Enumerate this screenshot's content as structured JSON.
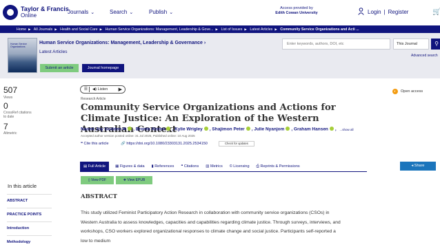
{
  "header": {
    "logo_line1": "Taylor & Francis",
    "logo_line2": "Online",
    "nav": [
      "Journals",
      "Search",
      "Publish"
    ],
    "access_label": "Access provided by",
    "access_org": "Edith Cowan University",
    "login": "Login",
    "register": "Register"
  },
  "breadcrumb": [
    "Home",
    "All Journals",
    "Health and Social Care",
    "Human Service Organizations: Management, Leadership & Gove...",
    "List of Issues",
    "Latest Articles",
    "Community Service Organizations and Acti ..."
  ],
  "journal": {
    "cover_title": "Human Service Organizations",
    "title": "Human Service Organizations: Management, Leadership & Governance",
    "issue": "Latest Articles",
    "submit": "Submit an article",
    "homepage": "Journal homepage"
  },
  "search": {
    "placeholder": "Enter keywords, authors, DOI, etc",
    "scope": "This Journal",
    "advanced": "Advanced search"
  },
  "metrics": [
    {
      "value": "507",
      "label": "Views"
    },
    {
      "value": "0",
      "label": "CrossRef citations to date"
    },
    {
      "value": "7",
      "label": "Altmetric"
    }
  ],
  "article": {
    "listen": "Listen",
    "type": "Research Article",
    "title": "Community Service Organizations and Actions for Climate Justice: An Exploration of the Western Australian Context",
    "authors": [
      "Naomi Joy Godden",
      "Bronte Alston",
      "Kylie Wrigley",
      "Shajimon Peter",
      "Julie Nyanjom",
      "Graham Hansen"
    ],
    "show_all": "...show all",
    "dates": "Accepted author version posted online: 31 Jul 2025, Published online: 10 Aug 2025",
    "cite": "Cite this article",
    "doi": "https://doi.org/10.1080/23303131.2025.2534150",
    "check_updates": "Check for updates",
    "open_access": "Open access"
  },
  "tabs": [
    "Full Article",
    "Figures & data",
    "References",
    "Citations",
    "Metrics",
    "Licensing",
    "Reprints & Permissions"
  ],
  "share": "Share",
  "downloads": {
    "pdf": "View PDF",
    "epub": "View EPUB"
  },
  "sidebar": {
    "heading": "In this article",
    "items": [
      "ABSTRACT",
      "PRACTICE POINTS",
      "Introduction",
      "Methodology"
    ]
  },
  "abstract": {
    "heading": "ABSTRACT",
    "text": "This study utilized Feminist Participatory Action Research in collaboration with community service organizations (CSOs) in Western Australia to assess knowledges, capacities and capabilities regarding climate justice. Through surveys, interviews, and workshops, CSO workers explored organizational responses to climate change and social justice. Participants self-reported a low to medium"
  }
}
